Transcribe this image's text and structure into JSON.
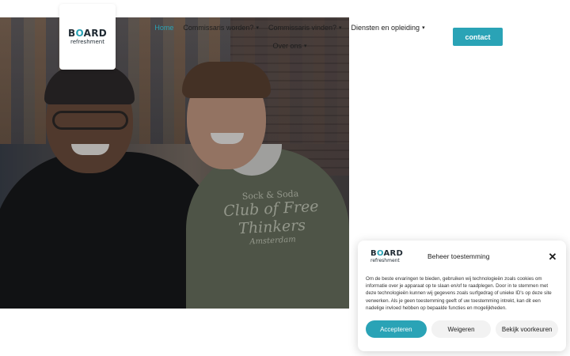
{
  "header": {
    "logo_word": "BOARD",
    "logo_sub": "refreshment",
    "nav": [
      {
        "label": "Home",
        "active": true,
        "dropdown": false
      },
      {
        "label": "Commissaris worden?",
        "active": false,
        "dropdown": true
      },
      {
        "label": "Commissaris vinden?",
        "active": false,
        "dropdown": true
      },
      {
        "label": "Diensten en opleiding",
        "active": false,
        "dropdown": true
      },
      {
        "label": "Over ons",
        "active": false,
        "dropdown": true
      }
    ],
    "chevron_icon": "chevron-down-icon",
    "contact_label": "contact"
  },
  "hero": {
    "sweater_line1": "Sock & Soda",
    "sweater_line2": "Club of Free Thinkers",
    "sweater_line3": "Amsterdam"
  },
  "consent": {
    "logo_word": "BOARD",
    "logo_sub": "refreshment",
    "title": "Beheer toestemming",
    "close_icon": "close-icon",
    "body": "Om de beste ervaringen te bieden, gebruiken wij technologieën zoals cookies om informatie over je apparaat op te slaan en/of te raadplegen. Door in te stemmen met deze technologieën kunnen wij gegevens zoals surfgedrag of unieke ID's op deze site verwerken. Als je geen toestemming geeft of uw toestemming intrekt, kan dit een nadelige invloed hebben op bepaalde functies en mogelijkheden.",
    "accept_label": "Accepteren",
    "deny_label": "Weigeren",
    "prefs_label": "Bekijk voorkeuren"
  },
  "colors": {
    "accent": "#2aa3b6",
    "text": "#1e1e1e",
    "button_neutral": "#f2f2f2"
  }
}
